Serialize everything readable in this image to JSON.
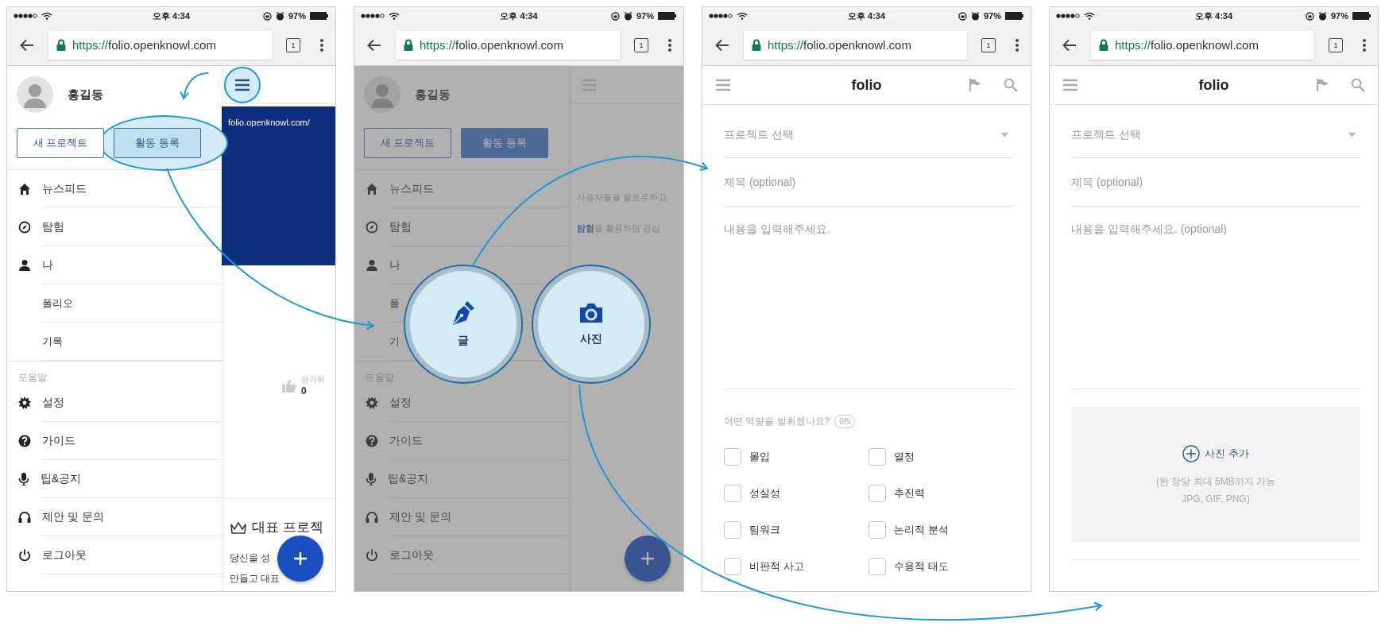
{
  "screens": [
    {
      "kind": "drawer",
      "dimmed": false,
      "status_bar": {
        "time": "오후 4:34",
        "battery": "97%"
      },
      "browser": {
        "scheme": "https://",
        "host": "folio.openknowl.com",
        "tab_count": "1"
      },
      "drawer": {
        "user_name": "홍길동",
        "buttons": [
          {
            "label": "새 프로젝트",
            "kind": "outline",
            "highlighted": false
          },
          {
            "label": "활동 등록",
            "kind": "filled",
            "highlighted": true
          }
        ],
        "items": [
          {
            "label": "뉴스피드"
          },
          {
            "label": "탐험"
          },
          {
            "label": "나",
            "children": [
              {
                "label": "폴리오"
              },
              {
                "label": "기록"
              }
            ]
          }
        ],
        "section": "도움말",
        "help_items": [
          {
            "label": "설정"
          },
          {
            "label": "가이드"
          },
          {
            "label": "팁&공지"
          },
          {
            "label": "제안 및 문의"
          },
          {
            "label": "로그아웃"
          }
        ]
      },
      "page": {
        "menu_highlighted": true,
        "banner_url": "folio.openknowl.com/",
        "rating_label": "평가하",
        "rating_count": "0",
        "section_title": "대표 프로젝",
        "body_lines": [
          "당신을 성",
          "만들고 대표"
        ]
      }
    },
    {
      "kind": "drawer",
      "dimmed": true,
      "status_bar": {
        "time": "오후 4:34",
        "battery": "97%"
      },
      "browser": {
        "scheme": "https://",
        "host": "folio.openknowl.com",
        "tab_count": "1"
      },
      "drawer": {
        "user_name": "홍길동",
        "buttons": [
          {
            "label": "새 프로젝트",
            "kind": "outline",
            "highlighted": false
          },
          {
            "label": "활동 등록",
            "kind": "filled",
            "highlighted": false
          }
        ],
        "items": [
          {
            "label": "뉴스피드"
          },
          {
            "label": "탐험"
          },
          {
            "label": "나",
            "children": [
              {
                "label": "폴"
              },
              {
                "label": "기"
              }
            ]
          }
        ],
        "section": "도움말",
        "help_items": [
          {
            "label": "설정"
          },
          {
            "label": "가이드"
          },
          {
            "label": "팁&공지"
          },
          {
            "label": "제안 및 문의"
          },
          {
            "label": "로그아웃"
          }
        ]
      },
      "page": {
        "menu_highlighted": false,
        "hint_lines": [
          "사용자들을 팔로우하고",
          "**탐험**을 활용하면 관심"
        ]
      },
      "actions": [
        {
          "label": "글"
        },
        {
          "label": "사진"
        }
      ]
    },
    {
      "kind": "compose",
      "status_bar": {
        "time": "오후 4:34",
        "battery": "97%"
      },
      "browser": {
        "scheme": "https://",
        "host": "folio.openknowl.com",
        "tab_count": "1"
      },
      "app_title": "folio",
      "form": {
        "project": {
          "placeholder": "프로젝트 선택"
        },
        "title": {
          "placeholder": "제목 (optional)"
        },
        "body": {
          "placeholder": "내용을 입력해주세요."
        },
        "question": "어떤 역량을 발휘했나요?",
        "count": "0/5",
        "competencies": [
          {
            "label": "몰입",
            "checked": false
          },
          {
            "label": "열정",
            "checked": false
          },
          {
            "label": "성실성",
            "checked": false
          },
          {
            "label": "추진력",
            "checked": false
          },
          {
            "label": "팀워크",
            "checked": false
          },
          {
            "label": "논리적 분석",
            "checked": false
          },
          {
            "label": "비판적 사고",
            "checked": false
          },
          {
            "label": "수용적 태도",
            "checked": false
          }
        ]
      }
    },
    {
      "kind": "compose",
      "status_bar": {
        "time": "오후 4:34",
        "battery": "97%"
      },
      "browser": {
        "scheme": "https://",
        "host": "folio.openknowl.com",
        "tab_count": "1"
      },
      "app_title": "folio",
      "form": {
        "project": {
          "placeholder": "프로젝트 선택"
        },
        "title": {
          "placeholder": "제목 (optional)"
        },
        "body": {
          "placeholder": "내용을 입력해주세요. (optional)"
        },
        "photo": {
          "label": "사진 추가",
          "hint_lines": [
            "(한 장당 최대 5MB까지 가능",
            "JPG, GIF, PNG)"
          ]
        }
      }
    }
  ]
}
